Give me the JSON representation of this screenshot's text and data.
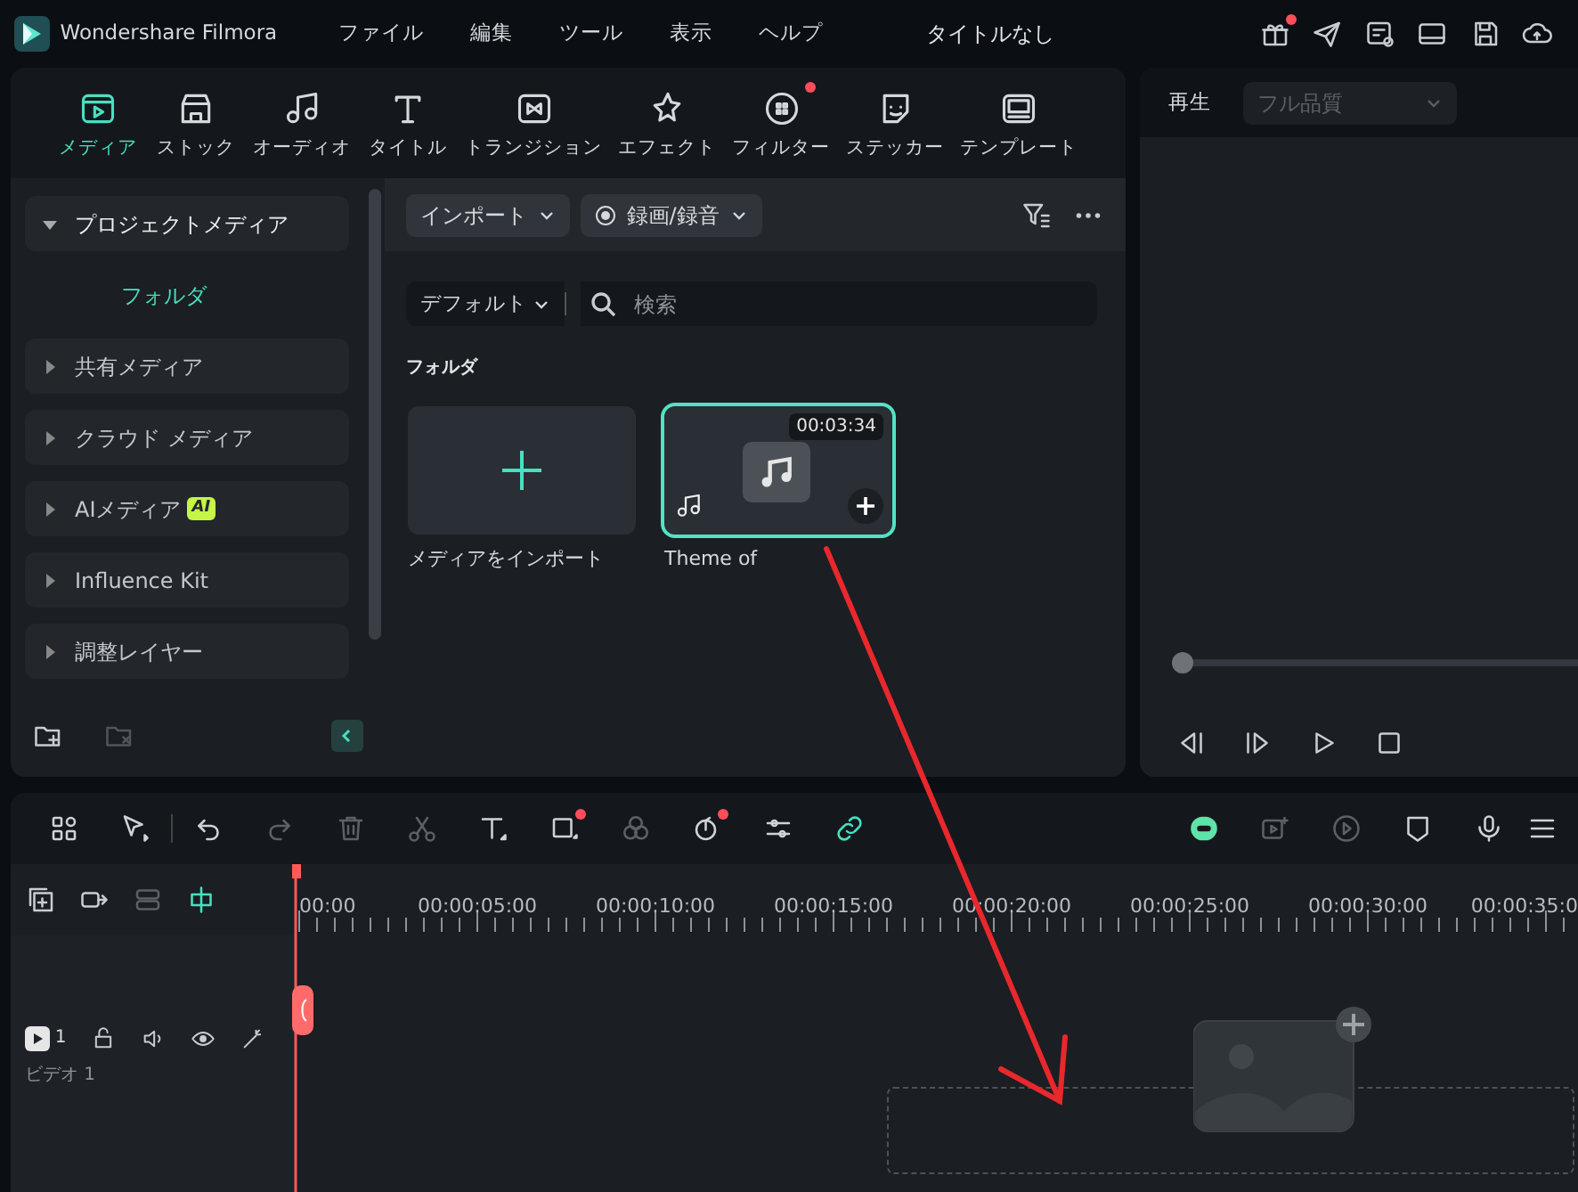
{
  "app": {
    "name": "Wondershare Filmora",
    "menus": [
      "ファイル",
      "編集",
      "ツール",
      "表示",
      "ヘルプ"
    ],
    "title": "タイトルなし",
    "actions": [
      {
        "dot": true
      },
      {
        "dot": false
      },
      {
        "dot": false
      },
      {
        "dot": false
      },
      {
        "dot": false
      },
      {
        "dot": false
      }
    ]
  },
  "tabs": [
    {
      "label": "メディア",
      "selected": true,
      "dot": false
    },
    {
      "label": "ストック",
      "selected": false,
      "dot": false
    },
    {
      "label": "オーディオ",
      "selected": false,
      "dot": false
    },
    {
      "label": "タイトル",
      "selected": false,
      "dot": false
    },
    {
      "label": "トランジション",
      "selected": false,
      "dot": false
    },
    {
      "label": "エフェクト",
      "selected": false,
      "dot": false
    },
    {
      "label": "フィルター",
      "selected": false,
      "dot": true
    },
    {
      "label": "ステッカー",
      "selected": false,
      "dot": false
    },
    {
      "label": "テンプレート",
      "selected": false,
      "dot": false
    }
  ],
  "sidebar": {
    "items": [
      {
        "label": "プロジェクトメディア",
        "expanded": true,
        "children": [
          {
            "label": "フォルダ",
            "selected": true
          }
        ]
      },
      {
        "label": "共有メディア",
        "expanded": false
      },
      {
        "label": "クラウド メディア",
        "expanded": false
      },
      {
        "label": "AIメディア",
        "expanded": false,
        "badge": "AI"
      },
      {
        "label": "Influence Kit",
        "expanded": false
      },
      {
        "label": "調整レイヤー",
        "expanded": false
      }
    ],
    "footer": [
      {
        "disabled": false
      },
      {
        "disabled": true
      }
    ]
  },
  "media": {
    "import_button": "インポート",
    "record_button": "録画/録音",
    "sort": "デフォルト",
    "search": {
      "placeholder": "検索"
    },
    "section": "フォルダ",
    "items": [
      {
        "kind": "import",
        "label": "メディアをインポート",
        "selected": false
      },
      {
        "kind": "audio",
        "label": "Theme of",
        "duration": "00:03:34",
        "selected": true
      }
    ]
  },
  "player": {
    "label": "再生",
    "quality": "フル品質",
    "level": 0
  },
  "timeline": {
    "tools": [
      {
        "disabled": false,
        "dot": false,
        "on": false
      },
      {
        "disabled": false,
        "dot": false,
        "on": false
      },
      {
        "disabled": false,
        "dot": false,
        "on": false
      },
      {
        "disabled": true,
        "dot": false,
        "on": false
      },
      {
        "disabled": true,
        "dot": false,
        "on": false
      },
      {
        "disabled": true,
        "dot": false,
        "on": false
      },
      {
        "disabled": false,
        "dot": false,
        "on": false
      },
      {
        "disabled": false,
        "dot": true,
        "on": false
      },
      {
        "disabled": true,
        "dot": false,
        "on": false
      },
      {
        "disabled": false,
        "dot": true,
        "on": false
      },
      {
        "disabled": false,
        "dot": false,
        "on": false
      },
      {
        "disabled": false,
        "dot": false,
        "on": true
      }
    ],
    "right_tools": [
      {
        "disabled": false,
        "on": true
      },
      {
        "disabled": true,
        "on": false
      },
      {
        "disabled": true,
        "on": false
      },
      {
        "disabled": false,
        "on": false
      },
      {
        "disabled": false,
        "on": false
      },
      {
        "disabled": false,
        "on": false
      }
    ],
    "ruler": [
      "00:00",
      "00:00:05:00",
      "00:00:10:00",
      "00:00:15:00",
      "00:00:20:00",
      "00:00:25:00",
      "00:00:30:00",
      "00:00:35:0"
    ],
    "track": {
      "count": "1",
      "name": "ビデオ 1"
    }
  }
}
